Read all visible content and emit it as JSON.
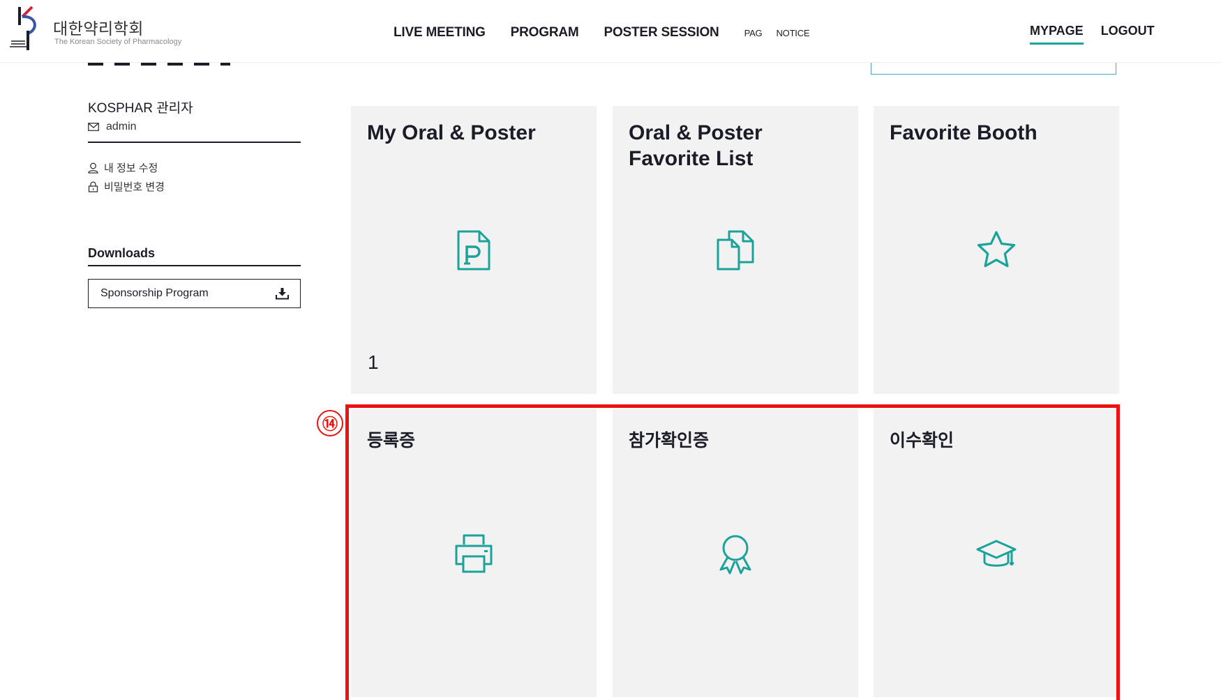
{
  "header": {
    "logo_ko": "대한약리학회",
    "logo_en": "The Korean Society of Pharmacology",
    "logo_mark": "KSP",
    "nav": [
      "LIVE MEETING",
      "PROGRAM",
      "POSTER SESSION",
      "PAG",
      "NOTICE"
    ],
    "user_menu": {
      "mypage": "MYPAGE",
      "logout": "LOGOUT"
    }
  },
  "sidebar": {
    "user_name": "KOSPHAR 관리자",
    "user_id": "admin",
    "links": {
      "edit_profile": "내 정보 수정",
      "change_password": "비밀번호 변경"
    },
    "downloads_title": "Downloads",
    "download_item": "Sponsorship Program"
  },
  "cards": {
    "my_oral_poster": {
      "title": "My Oral & Poster",
      "count": "1",
      "icon": "poster-p-icon"
    },
    "favorite_list": {
      "title": "Oral & Poster Favorite List",
      "icon": "documents-icon"
    },
    "favorite_booth": {
      "title": "Favorite Booth",
      "icon": "star-icon"
    },
    "registration": {
      "title": "등록증",
      "icon": "printer-icon"
    },
    "attendance": {
      "title": "참가확인증",
      "icon": "award-ribbon-icon"
    },
    "completion": {
      "title": "이수확인",
      "icon": "graduation-cap-icon"
    }
  },
  "annotation": {
    "badge": "⑭"
  },
  "colors": {
    "accent": "#1aa39a",
    "card_bg": "#f2f2f2",
    "highlight": "#ee1111",
    "text": "#1c1c28"
  }
}
